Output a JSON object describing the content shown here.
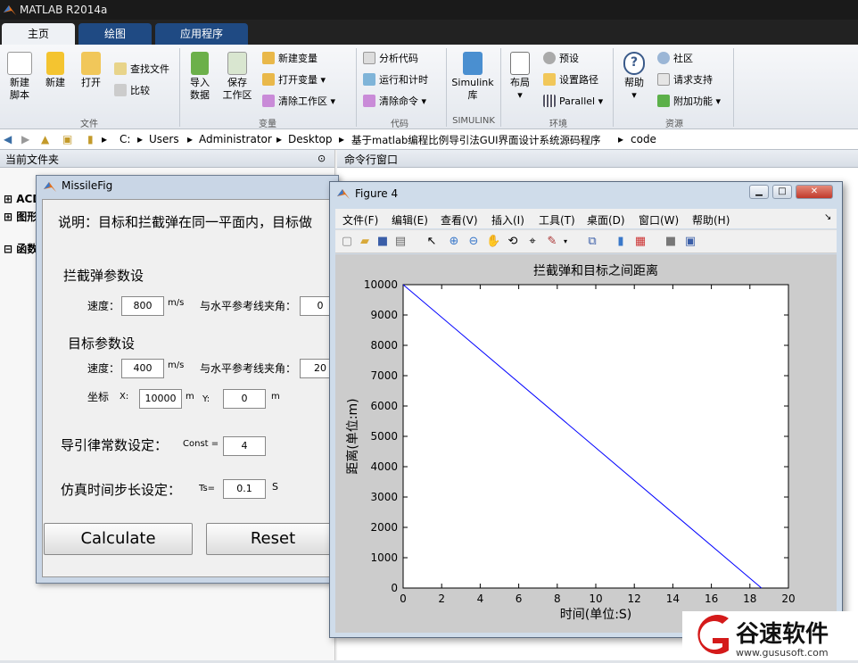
{
  "window_title": "MATLAB R2014a",
  "tabs": [
    {
      "label": "主页"
    },
    {
      "label": "绘图"
    },
    {
      "label": "应用程序"
    }
  ],
  "ribbon": {
    "new_script": "新建\n脚本",
    "new": "新建",
    "open": "打开",
    "find_files": "查找文件",
    "compare": "比较",
    "group_file": "文件",
    "import_data": "导入\n数据",
    "save_workspace": "保存\n工作区",
    "new_variable": "新建变量",
    "open_variable": "打开变量",
    "clear_workspace": "清除工作区",
    "group_variable": "变量",
    "analyze_code": "分析代码",
    "run_and_time": "运行和计时",
    "clear_commands": "清除命令",
    "group_code": "代码",
    "simulink": "Simulink\n库",
    "group_simulink": "SIMULINK",
    "layout": "布局",
    "preferences": "预设",
    "set_path": "设置路径",
    "parallel": "Parallel",
    "group_environment": "环境",
    "help": "帮助",
    "community": "社区",
    "request_support": "请求支持",
    "add_ons": "附加功能",
    "group_resources": "资源"
  },
  "address": {
    "segments": [
      "C:",
      "Users",
      "Administrator",
      "Desktop",
      "基于matlab编程比例导引法GUI界面设计系统源码程序",
      "code"
    ]
  },
  "current_folder": {
    "title": "当前文件夹",
    "items": [
      "ACD",
      "图形",
      "函数"
    ]
  },
  "command_window": {
    "title": "命令行窗口"
  },
  "missile_fig": {
    "title": "MissileFig",
    "description": "说明：目标和拦截弹在同一平面内，目标做",
    "interceptor_header": "拦截弹参数设",
    "speed_label": "速度：",
    "interceptor_speed": "800",
    "speed_unit": "m/s",
    "angle_label": "与水平参考线夹角：",
    "interceptor_angle": "0",
    "target_header": "目标参数设",
    "target_speed": "400",
    "target_angle": "20",
    "coord_label": "坐标",
    "x_label": "X:",
    "target_x": "10000",
    "y_label": "Y:",
    "target_y": "0",
    "m_unit": "m",
    "guidance_label": "导引律常数设定：",
    "const_label": "Const =",
    "const_value": "4",
    "step_label": "仿真时间步长设定：",
    "ts_label": "Ts=",
    "ts_value": "0.1",
    "s_unit": "S",
    "calc_button": "Calculate",
    "reset_button": "Reset"
  },
  "figure4": {
    "title": "Figure 4",
    "menu": [
      "文件(F)",
      "编辑(E)",
      "查看(V)",
      "插入(I)",
      "工具(T)",
      "桌面(D)",
      "窗口(W)",
      "帮助(H)"
    ]
  },
  "chart_data": {
    "type": "line",
    "title": "拦截弹和目标之间距离",
    "xlabel": "时间(单位:S)",
    "ylabel": "距离(单位:m)",
    "xlim": [
      0,
      20
    ],
    "ylim": [
      0,
      10000
    ],
    "xticks": [
      0,
      2,
      4,
      6,
      8,
      10,
      12,
      14,
      16,
      18,
      20
    ],
    "yticks": [
      0,
      1000,
      2000,
      3000,
      4000,
      5000,
      6000,
      7000,
      8000,
      9000,
      10000
    ],
    "grid": false,
    "color": "#0000ff",
    "series": [
      {
        "x": [
          0,
          18.6
        ],
        "y": [
          10000,
          0
        ]
      }
    ]
  },
  "watermark": {
    "text": "谷速软件",
    "url": "www.gususoft.com"
  },
  "colors": {
    "matlab_tab": "#1f4a83",
    "line": "#0000ff",
    "logo_red": "#d41a1a"
  }
}
